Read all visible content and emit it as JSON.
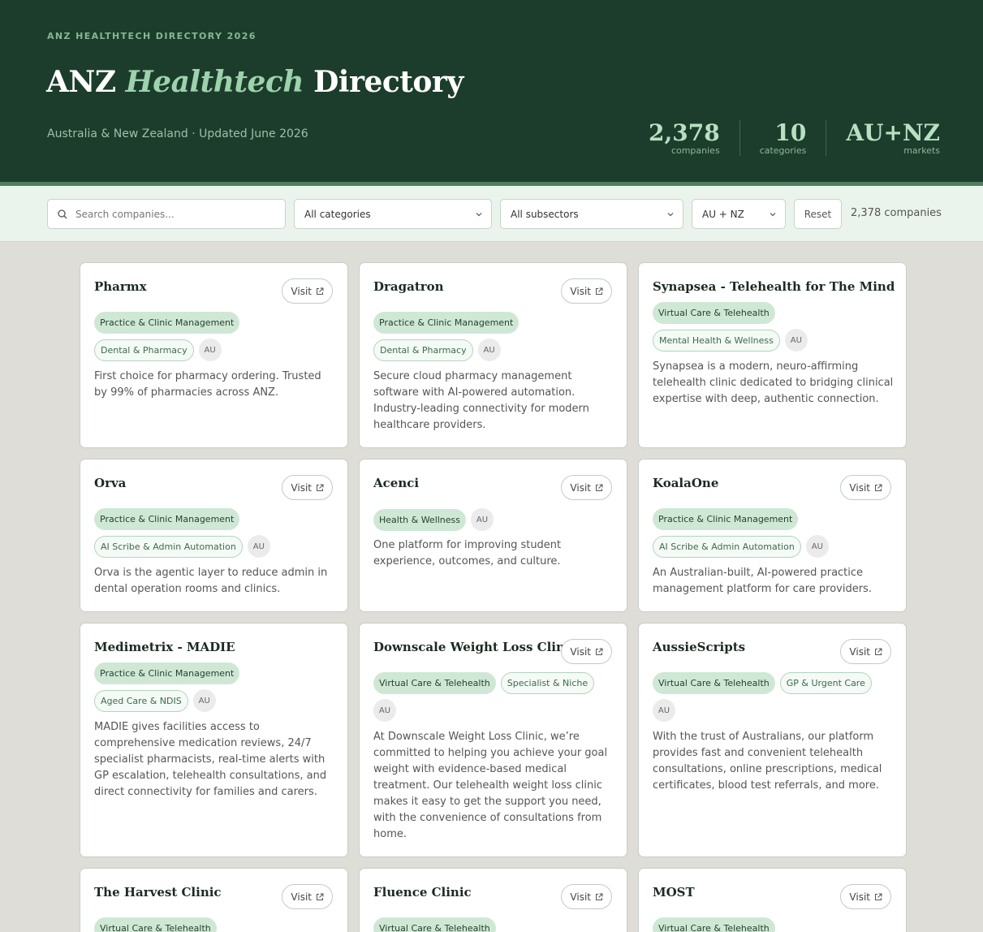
{
  "header": {
    "eyebrow": "ANZ HEALTHTECH DIRECTORY 2026",
    "title_pre": "ANZ",
    "title_em": "Healthtech",
    "title_post": "Directory",
    "subtitle": "Australia & New Zealand · Updated June 2026",
    "stats": [
      {
        "value": "2,378",
        "label": "companies"
      },
      {
        "value": "10",
        "label": "categories"
      },
      {
        "value": "AU+NZ",
        "label": "markets"
      }
    ]
  },
  "filters": {
    "search_placeholder": "Search companies...",
    "category": "All categories",
    "subsector": "All subsectors",
    "market": "AU + NZ",
    "reset": "Reset",
    "count": "2,378 companies"
  },
  "visit_label": "Visit",
  "companies": [
    {
      "name": "Pharmx",
      "tags": [
        "Practice & Clinic Management",
        "Dental & Pharmacy"
      ],
      "market": "AU",
      "description": "First choice for pharmacy ordering. Trusted by 99% of pharmacies across ANZ."
    },
    {
      "name": "Dragatron",
      "tags": [
        "Practice & Clinic Management",
        "Dental & Pharmacy"
      ],
      "market": "AU",
      "description": "Secure cloud pharmacy management software with AI-powered automation. Industry-leading connectivity for modern healthcare providers."
    },
    {
      "name": "Synapsea - Telehealth for The Mind",
      "tags": [
        "Virtual Care & Telehealth",
        "Mental Health & Wellness"
      ],
      "market": "AU",
      "description": "Synapsea is a modern, neuro-affirming telehealth clinic dedicated to bridging clinical expertise with deep, authentic connection."
    },
    {
      "name": "Orva",
      "tags": [
        "Practice & Clinic Management",
        "AI Scribe & Admin Automation"
      ],
      "market": "AU",
      "description": "Orva is the agentic layer to reduce admin in dental operation rooms and clinics."
    },
    {
      "name": "Acenci",
      "tags": [
        "Health & Wellness"
      ],
      "market": "AU",
      "description": "One platform for improving student experience, outcomes, and culture."
    },
    {
      "name": "KoalaOne",
      "tags": [
        "Practice & Clinic Management",
        "AI Scribe & Admin Automation"
      ],
      "market": "AU",
      "description": "An Australian-built, AI-powered practice management platform for care providers."
    },
    {
      "name": "Medimetrix - MADIE",
      "tags": [
        "Practice & Clinic Management",
        "Aged Care & NDIS"
      ],
      "market": "AU",
      "description": "MADIE gives facilities access to comprehensive medication reviews, 24/7 specialist pharmacists, real-time alerts with GP escalation, telehealth consultations, and direct connectivity for families and carers."
    },
    {
      "name": "Downscale Weight Loss Clinic",
      "tags": [
        "Virtual Care & Telehealth",
        "Specialist & Niche"
      ],
      "market": "AU",
      "description": "At Downscale Weight Loss Clinic, we’re committed to helping you achieve your goal weight with evidence-based medical treatment. Our telehealth weight loss clinic makes it easy to get the support you need, with the convenience of consultations from home."
    },
    {
      "name": "AussieScripts",
      "tags": [
        "Virtual Care & Telehealth",
        "GP & Urgent Care"
      ],
      "market": "AU",
      "description": "With the trust of Australians, our platform provides fast and convenient telehealth consultations, online prescriptions, medical certificates, blood test referrals, and more."
    },
    {
      "name": "The Harvest Clinic",
      "tags": [
        "Virtual Care & Telehealth"
      ],
      "market": "",
      "description": ""
    },
    {
      "name": "Fluence Clinic",
      "tags": [
        "Virtual Care & Telehealth"
      ],
      "market": "",
      "description": ""
    },
    {
      "name": "MOST",
      "tags": [
        "Virtual Care & Telehealth"
      ],
      "market": "",
      "description": ""
    }
  ]
}
